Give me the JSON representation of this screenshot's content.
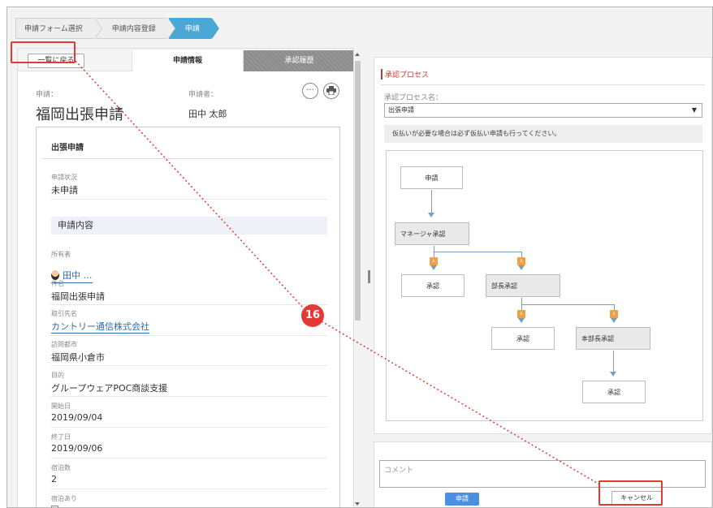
{
  "breadcrumb": [
    "申請フォーム選択",
    "申請内容登録",
    "申請"
  ],
  "left": {
    "back_label": "一覧に戻る",
    "tabs": [
      "申請情報",
      "承認履歴"
    ],
    "apply_label": "申請：",
    "applicant_label": "申請者：",
    "title": "福岡出張申請",
    "applicant": "田中 太郎",
    "more_icon": "ellipsis-icon",
    "print_icon": "print-icon",
    "card_title": "出張申請",
    "status_label": "申請状況",
    "status_value": "未申請",
    "section": "申請内容",
    "owner_label": "所有者",
    "owner_value": "田中 …",
    "subject_label": "件名",
    "subject_value": "福岡出張申請",
    "client_label": "取引先名",
    "client_value": "カントリー通信株式会社",
    "city_label": "訪問都市",
    "city_value": "福岡県小倉市",
    "purpose_label": "目的",
    "purpose_value": "グループウェアPOC商談支援",
    "start_label": "開始日",
    "start_value": "2019/09/04",
    "end_label": "終了日",
    "end_value": "2019/09/06",
    "nights_label": "宿泊数",
    "nights_value": "2",
    "stay_label": "宿泊あり"
  },
  "right": {
    "process_title": "承認プロセス",
    "process_name_label": "承認プロセス名：",
    "process_name_value": "出張申請",
    "notice": "仮払いが必要な場合は必ず仮払い申請も行ってください。",
    "flow": {
      "start": "申請",
      "manager": "マネージャ承認",
      "approve": "承認",
      "dept_head": "部長承認",
      "division_head": "本部長承認"
    }
  },
  "bottom": {
    "comment_placeholder": "コメント",
    "apply_label": "申請",
    "cancel_label": "キャンセル"
  },
  "step_number": "16",
  "colors": {
    "highlight": "#e53935",
    "accent": "#4aa7d6",
    "primary_button": "#4a8fe0"
  }
}
